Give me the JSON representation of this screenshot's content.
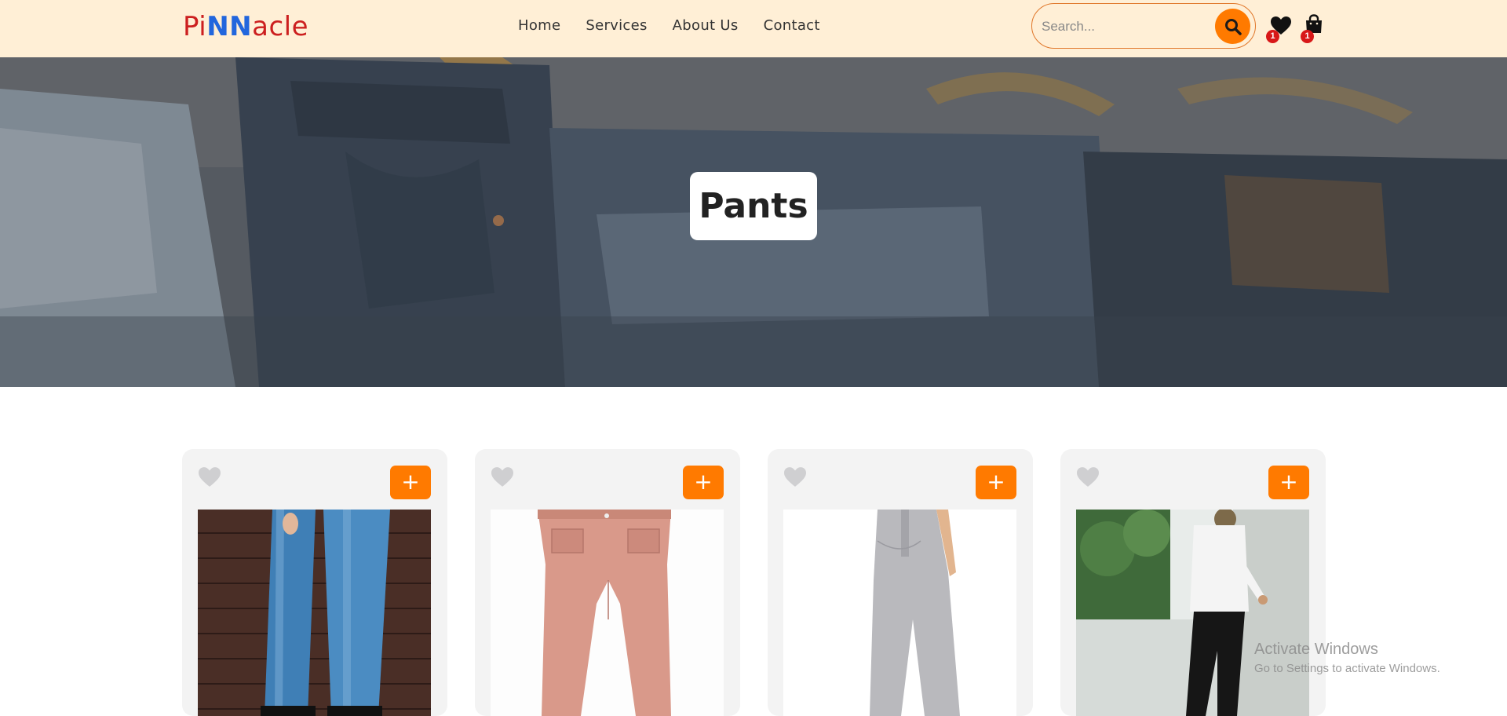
{
  "header": {
    "logo": {
      "part1": "Pi",
      "part2": "NN",
      "part3": "acle"
    },
    "nav": [
      {
        "label": "Home"
      },
      {
        "label": "Services"
      },
      {
        "label": "About Us"
      },
      {
        "label": "Contact"
      }
    ],
    "search": {
      "placeholder": "Search...",
      "icon": "search-icon"
    },
    "wishlist": {
      "icon": "heart-icon",
      "count": "1"
    },
    "cart": {
      "icon": "shopping-bag-icon",
      "count": "1"
    }
  },
  "hero": {
    "title": "Pants",
    "background": "hanging-jeans-photo"
  },
  "products": [
    {
      "image": "blue-patterned-jeans",
      "fav_icon": "heart-icon",
      "add_label": "+"
    },
    {
      "image": "pink-cargo-pants",
      "fav_icon": "heart-icon",
      "add_label": "+"
    },
    {
      "image": "grey-sweatpants",
      "fav_icon": "heart-icon",
      "add_label": "+"
    },
    {
      "image": "black-chino-pants",
      "fav_icon": "heart-icon",
      "add_label": "+"
    }
  ],
  "watermark": {
    "line1": "Activate Windows",
    "line2": "Go to Settings to activate Windows."
  },
  "colors": {
    "header_bg": "#ffefd6",
    "accent": "#ff7a00",
    "logo_red": "#cc1f1f",
    "logo_blue": "#2266dd",
    "badge": "#d81818"
  }
}
